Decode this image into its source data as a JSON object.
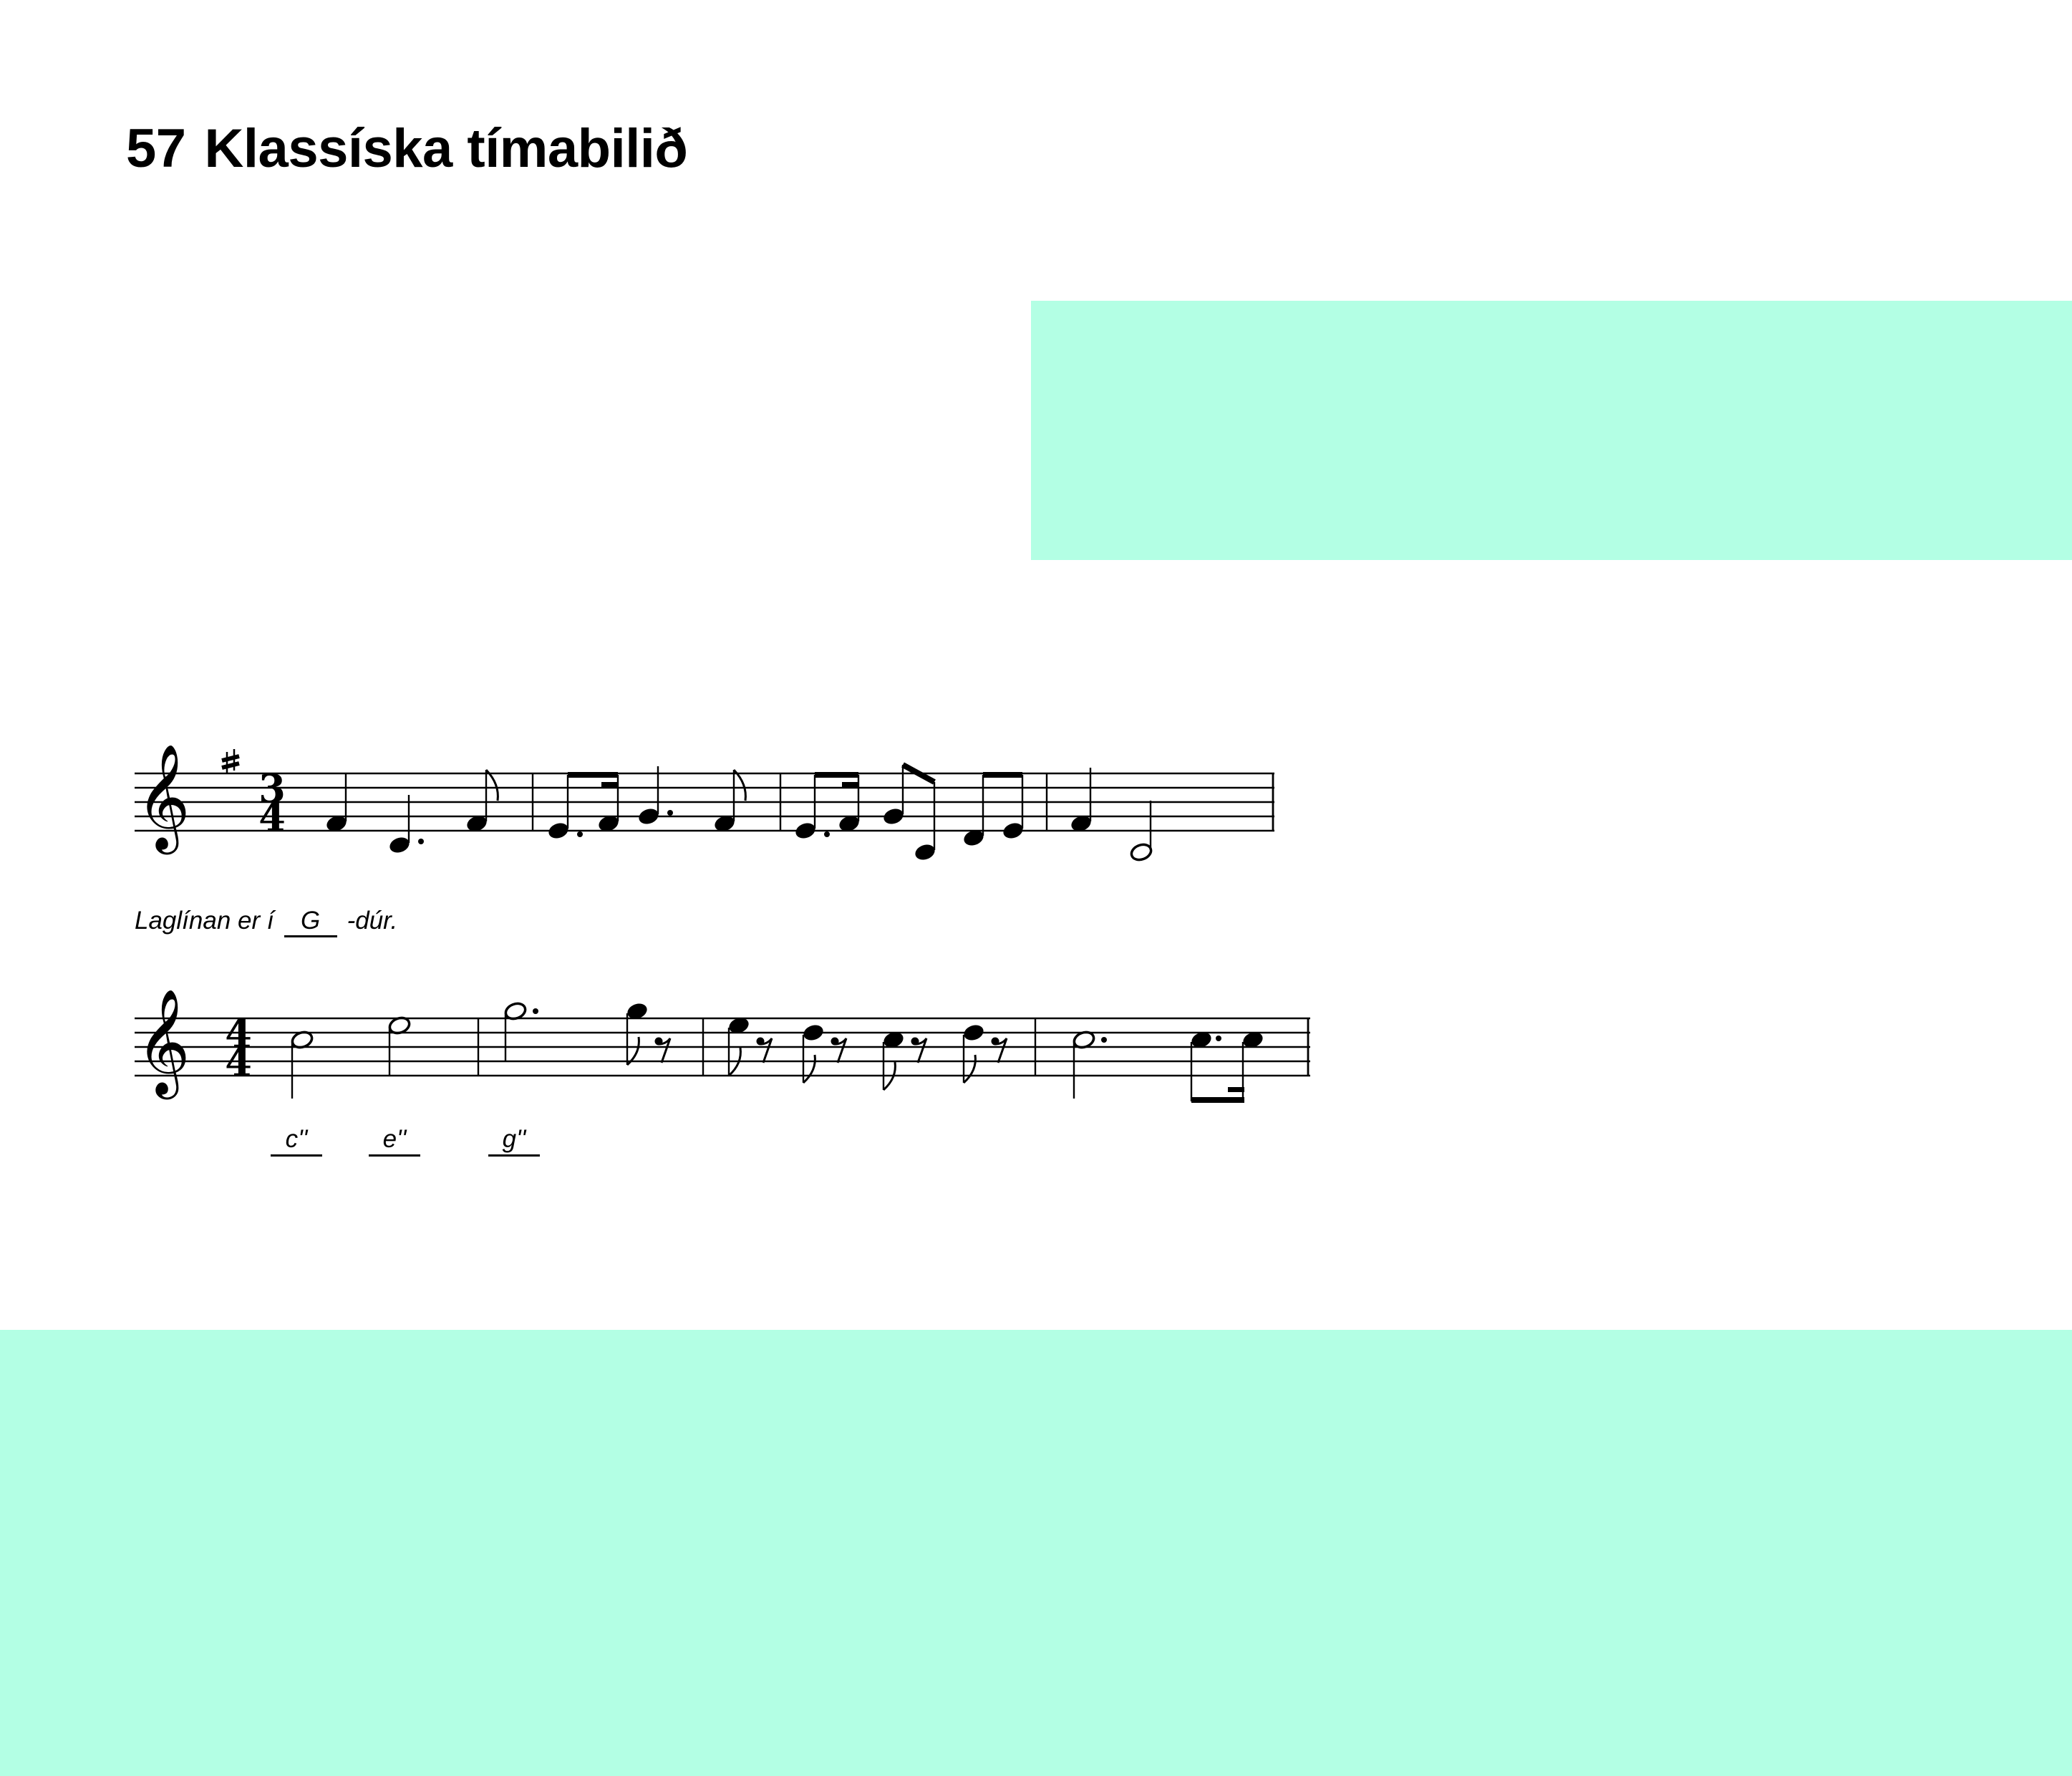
{
  "heading": {
    "number": "57",
    "title": "Klassíska tímabilið"
  },
  "colors": {
    "accent": "#b3ffe4",
    "ink": "#000000"
  },
  "exercise1": {
    "clef": "treble",
    "key_signature": "F#",
    "time_signature": "3/4",
    "caption_prefix": "Laglínan er í",
    "key_answer": "G",
    "caption_suffix": "-dúr."
  },
  "exercise2": {
    "clef": "treble",
    "time_signature": "4/4",
    "note_answers": [
      "c''",
      "e''",
      "g''"
    ]
  }
}
